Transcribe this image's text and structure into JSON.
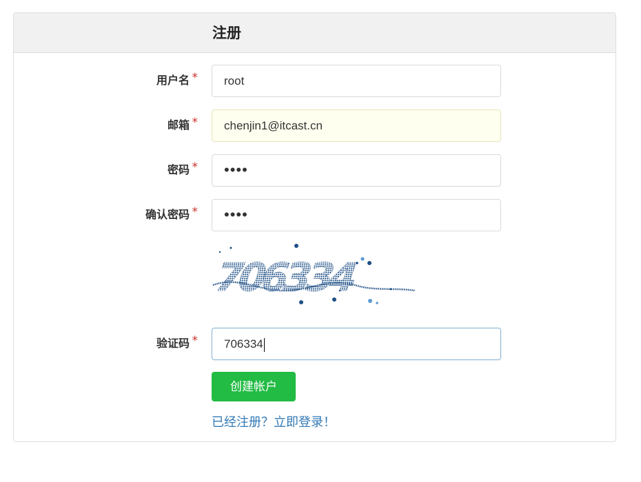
{
  "title": "注册",
  "fields": {
    "username": {
      "label": "用户名",
      "value": "root",
      "required_mark": "*"
    },
    "email": {
      "label": "邮箱",
      "value": "chenjin1@itcast.cn",
      "required_mark": "*"
    },
    "password": {
      "label": "密码",
      "value": "••••",
      "required_mark": "*"
    },
    "confirm_password": {
      "label": "确认密码",
      "value": "••••",
      "required_mark": "*"
    },
    "captcha_input": {
      "label": "验证码",
      "value": "706334",
      "required_mark": "*"
    }
  },
  "captcha_image": {
    "text": "706334"
  },
  "submit_button": "创建帐户",
  "login_link": "已经注册？立即登录！",
  "colors": {
    "button": "#22bb44",
    "link": "#337ab7",
    "required": "#c9302c",
    "captcha": "#1e4f86"
  }
}
